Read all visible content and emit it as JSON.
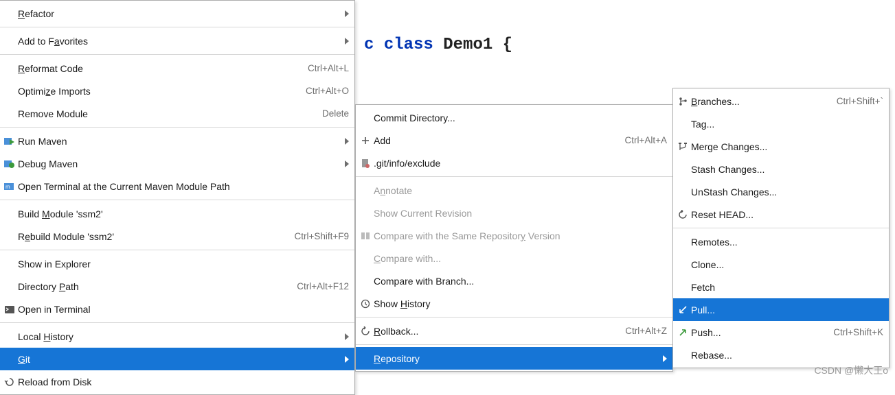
{
  "code": {
    "prefix": "c",
    "kw": "class",
    "rest": "Demo1 {"
  },
  "menu1": {
    "refactor": "Refactor",
    "add_favorites": "Add to Favorites",
    "reformat": "Reformat Code",
    "reformat_sc": "Ctrl+Alt+L",
    "optimize": "Optimize Imports",
    "optimize_sc": "Ctrl+Alt+O",
    "remove_module": "Remove Module",
    "remove_module_sc": "Delete",
    "run_maven": "Run Maven",
    "debug_maven": "Debug Maven",
    "open_terminal_maven": "Open Terminal at the Current Maven Module Path",
    "build_module": "Build Module 'ssm2'",
    "rebuild_module": "Rebuild Module 'ssm2'",
    "rebuild_module_sc": "Ctrl+Shift+F9",
    "show_explorer": "Show in Explorer",
    "directory_path": "Directory Path",
    "directory_path_sc": "Ctrl+Alt+F12",
    "open_in_terminal": "Open in Terminal",
    "local_history": "Local History",
    "git": "Git",
    "reload_disk": "Reload from Disk"
  },
  "menu2": {
    "commit_dir": "Commit Directory...",
    "add": "Add",
    "add_sc": "Ctrl+Alt+A",
    "git_exclude": ".git/info/exclude",
    "annotate": "Annotate",
    "show_current_rev": "Show Current Revision",
    "compare_same_repo": "Compare with the Same Repository Version",
    "compare_with": "Compare with...",
    "compare_branch": "Compare with Branch...",
    "show_history": "Show History",
    "rollback": "Rollback...",
    "rollback_sc": "Ctrl+Alt+Z",
    "repository": "Repository"
  },
  "menu3": {
    "branches": "Branches...",
    "branches_sc": "Ctrl+Shift+`",
    "tag": "Tag...",
    "merge": "Merge Changes...",
    "stash": "Stash Changes...",
    "unstash": "UnStash Changes...",
    "reset_head": "Reset HEAD...",
    "remotes": "Remotes...",
    "clone": "Clone...",
    "fetch": "Fetch",
    "pull": "Pull...",
    "push": "Push...",
    "push_sc": "Ctrl+Shift+K",
    "rebase": "Rebase..."
  },
  "watermark": "CSDN @懒大王o"
}
